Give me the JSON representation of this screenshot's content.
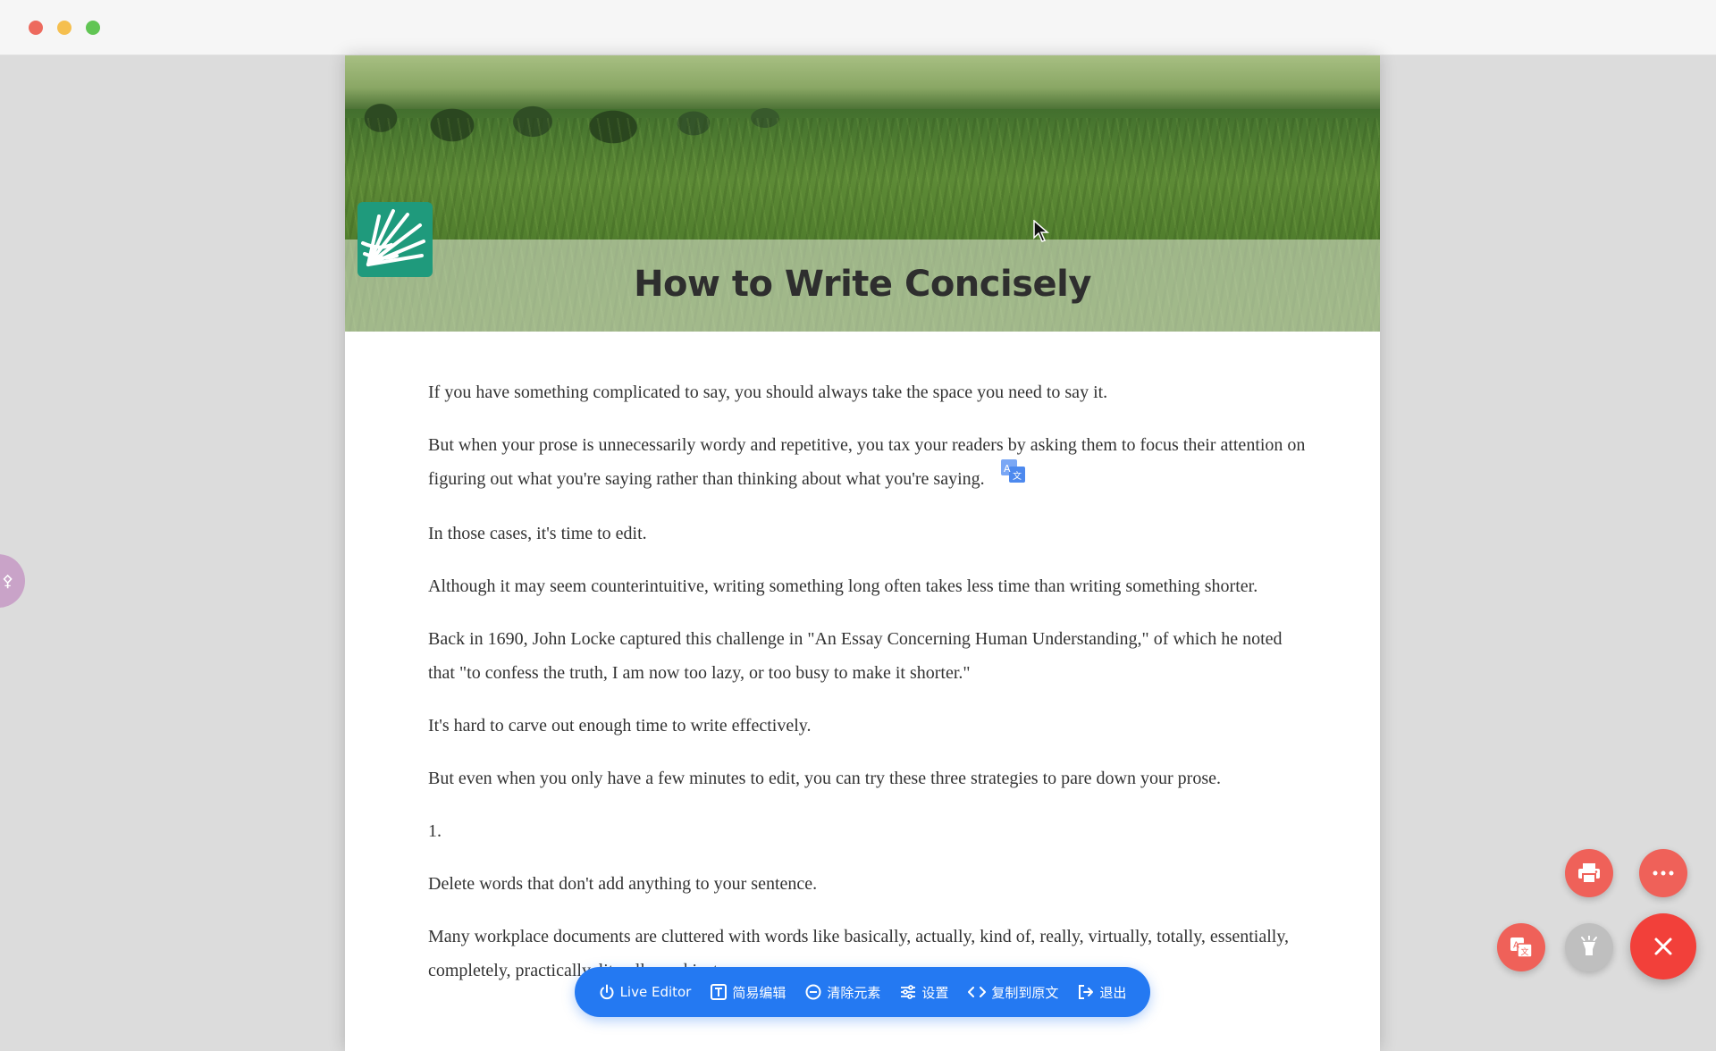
{
  "window": {
    "controls": [
      "close",
      "minimize",
      "maximize"
    ]
  },
  "article": {
    "title": "How to Write Concisely",
    "paragraphs": [
      "If you have something complicated to say, you should always take the space you need to say it.",
      "But when your prose is unnecessarily wordy and repetitive, you tax your readers by asking them to focus their attention on figuring out what you're saying rather than thinking about what you're saying.",
      "In those cases, it's time to edit.",
      "Although it may seem counterintuitive, writing something long often takes less time than writing something shorter.",
      "Back in 1690, John Locke captured this challenge in \"An Essay Concerning Human Understanding,\" of which he noted that \"to confess the truth, I am now too lazy, or too busy to make it shorter.\"",
      "It's hard to carve out enough time to write effectively.",
      "But even when you only have a few minutes to edit, you can try these three strategies to pare down your prose.",
      "1.",
      "Delete words that don't add anything to your sentence.",
      "Many workplace documents are cluttered with words like basically, actually, kind of, really, virtually, totally, essentially, completely, practically, literally, and just."
    ]
  },
  "toolbar": {
    "items": [
      {
        "label": "Live Editor",
        "icon": "power-icon"
      },
      {
        "label": "简易编辑",
        "icon": "text-box-icon"
      },
      {
        "label": "清除元素",
        "icon": "minus-circle-icon"
      },
      {
        "label": "设置",
        "icon": "sliders-icon"
      },
      {
        "label": "复制到原文",
        "icon": "code-icon"
      },
      {
        "label": "退出",
        "icon": "exit-icon"
      }
    ]
  },
  "fabs": {
    "print": "printer-icon",
    "more": "more-icon",
    "translate": "translate-icon",
    "focus": "lightbulb-icon",
    "close": "close-icon"
  },
  "colors": {
    "toolbar": "#2479f2",
    "fab_red": "#ef6159",
    "fab_close": "#f2403a",
    "logo": "#1f9a7c"
  }
}
